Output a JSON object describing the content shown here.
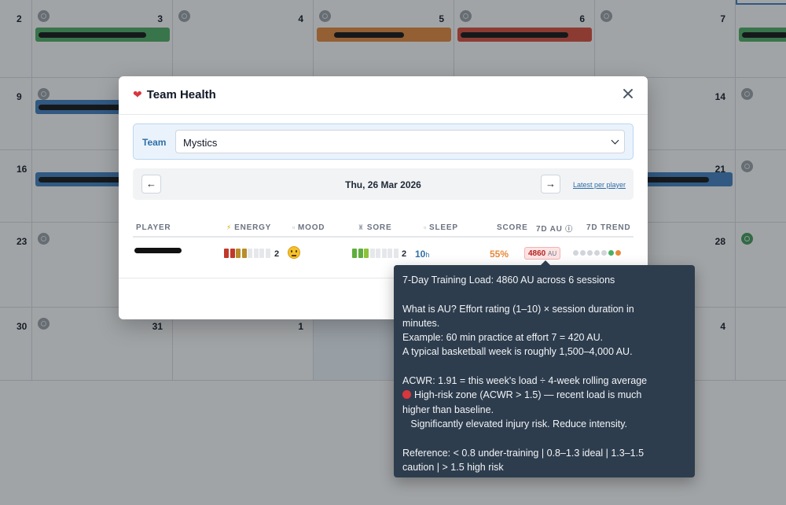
{
  "calendar": {
    "rows": [
      {
        "days": [
          "2",
          "3",
          "4",
          "5",
          "6",
          "7",
          ""
        ]
      },
      {
        "days": [
          "9",
          "",
          "",
          "",
          "",
          "14",
          ""
        ]
      },
      {
        "days": [
          "16",
          "",
          "",
          "",
          "",
          "21",
          ""
        ]
      },
      {
        "days": [
          "23",
          "",
          "",
          "",
          "",
          "28",
          ""
        ]
      },
      {
        "days": [
          "30",
          "31",
          "1",
          "",
          "",
          "4",
          ""
        ]
      }
    ]
  },
  "modal": {
    "title": "Team Health",
    "team_label": "Team",
    "team_value": "Mystics",
    "date": "Thu, 26 Mar 2026",
    "prev_label": "←",
    "next_label": "→",
    "latest_link": "Latest per player",
    "columns": {
      "player": "PLAYER",
      "energy": "ENERGY",
      "mood": "MOOD",
      "sore": "SORE",
      "sleep": "SLEEP",
      "score": "SCORE",
      "au": "7D AU",
      "trend": "7D TREND"
    },
    "row": {
      "energy_count": "2",
      "sore_count": "2",
      "sleep_value": "10",
      "sleep_unit": "h",
      "score": "55%",
      "au_value": "4860",
      "au_unit": "AU"
    }
  },
  "tooltip": {
    "line1": "7-Day Training Load: 4860 AU across 6 sessions",
    "line2": "What is AU?  Effort rating (1–10) × session duration in",
    "line3": "minutes.",
    "line4": "Example: 60 min practice at effort 7 = 420 AU.",
    "line5": "A typical basketball week is roughly 1,500–4,000 AU.",
    "line6": "ACWR: 1.91  =  this week's load ÷ 4-week rolling average",
    "line7": "High-risk zone (ACWR > 1.5) — recent load is much",
    "line8": "higher than baseline.",
    "line9": "   Significantly elevated injury risk. Reduce intensity.",
    "line10": "Reference:  < 0.8 under-training  |  0.8–1.3 ideal  |  1.3–1.5",
    "line11": "caution  |  > 1.5 high risk"
  },
  "colors": {
    "accent": "#2f6ea8",
    "danger": "#d9363e",
    "warning": "#e8893a",
    "tooltip_bg": "#2d3d4e"
  }
}
